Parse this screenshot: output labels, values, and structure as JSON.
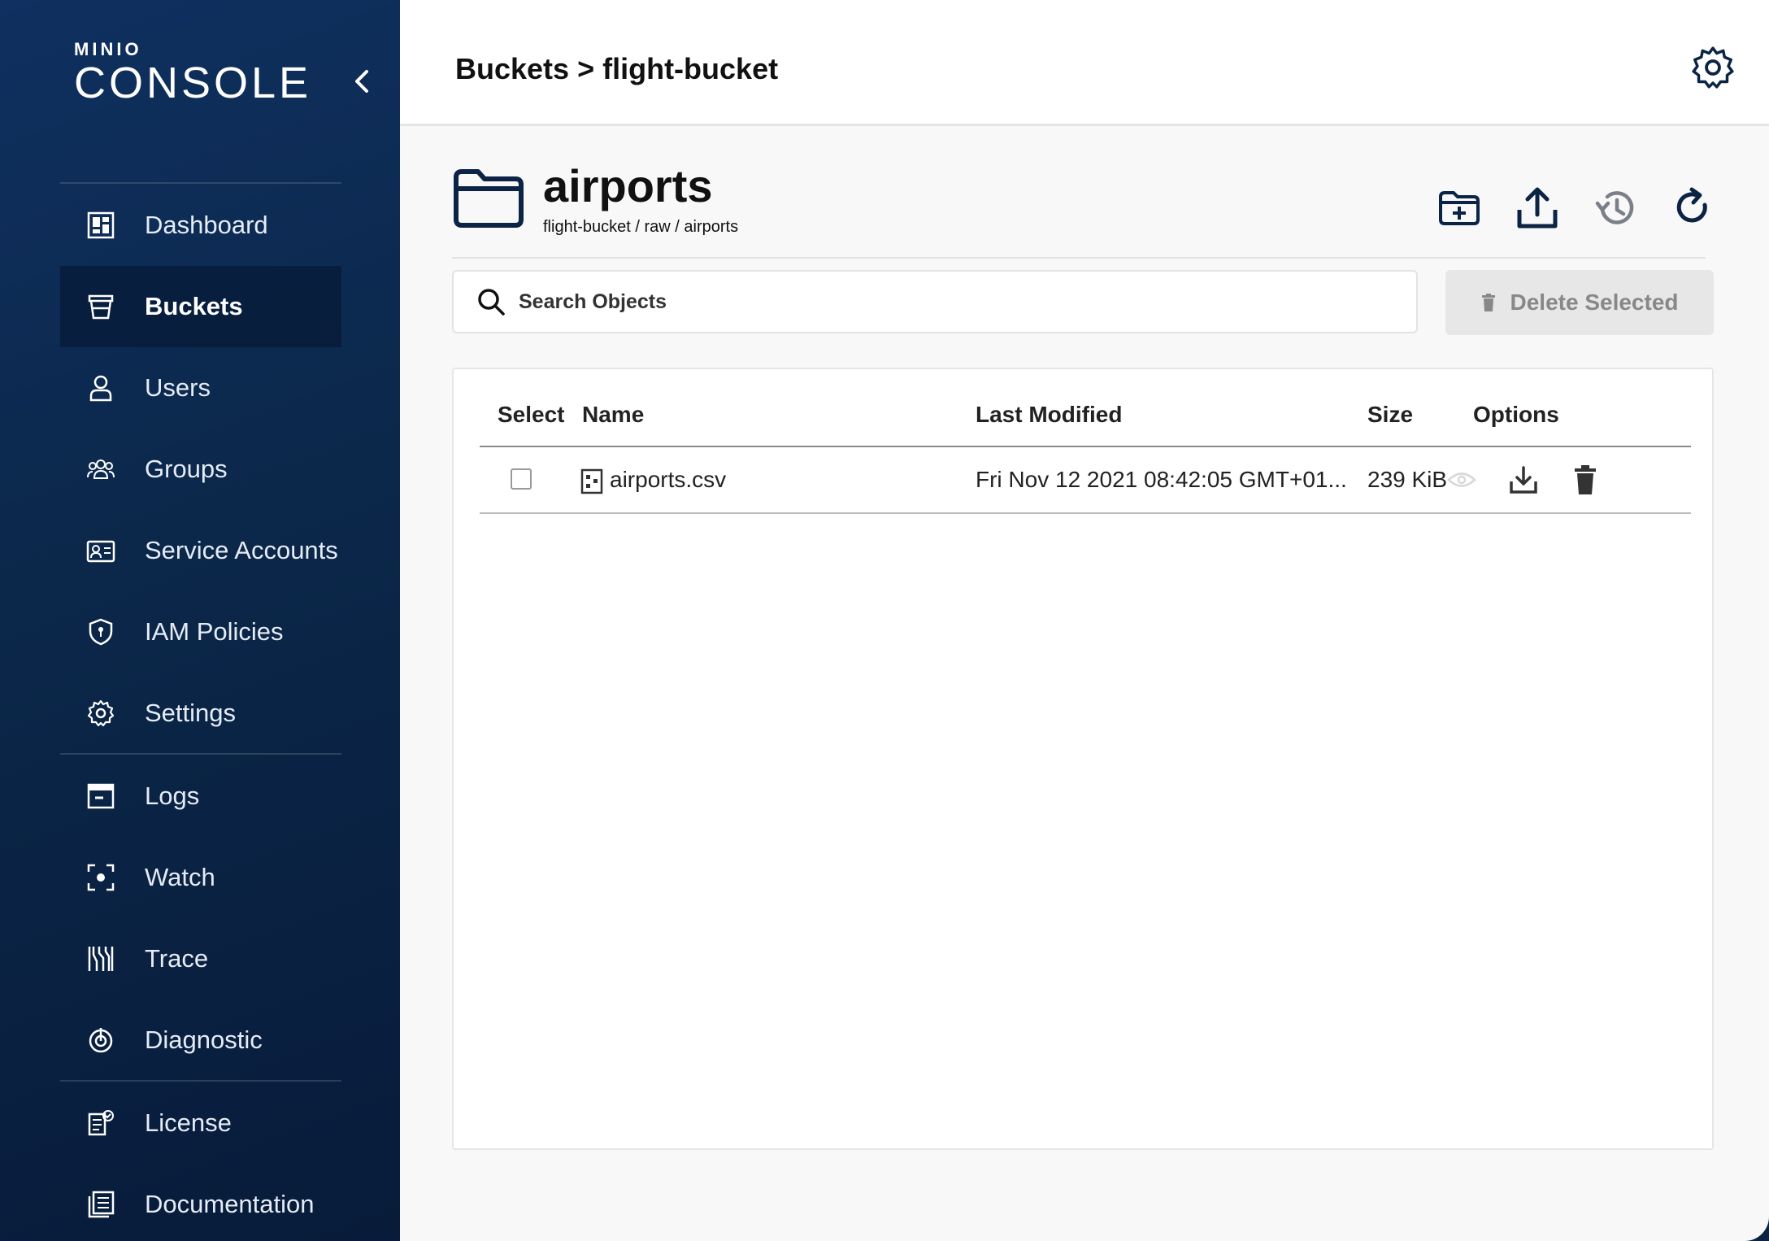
{
  "logo": {
    "top": "MINIO",
    "main": "CONSOLE"
  },
  "sidebar": {
    "items": [
      {
        "label": "Dashboard",
        "icon": "dashboard-icon"
      },
      {
        "label": "Buckets",
        "icon": "bucket-icon",
        "active": true
      },
      {
        "label": "Users",
        "icon": "user-icon"
      },
      {
        "label": "Groups",
        "icon": "groups-icon"
      },
      {
        "label": "Service Accounts",
        "icon": "service-account-icon"
      },
      {
        "label": "IAM Policies",
        "icon": "shield-icon"
      },
      {
        "label": "Settings",
        "icon": "gear-icon"
      },
      {
        "label": "Logs",
        "icon": "logs-icon"
      },
      {
        "label": "Watch",
        "icon": "watch-icon"
      },
      {
        "label": "Trace",
        "icon": "trace-icon"
      },
      {
        "label": "Diagnostic",
        "icon": "diagnostic-icon"
      },
      {
        "label": "License",
        "icon": "license-icon"
      },
      {
        "label": "Documentation",
        "icon": "documentation-icon"
      }
    ]
  },
  "header": {
    "breadcrumb": "Buckets > flight-bucket"
  },
  "folder": {
    "title": "airports",
    "path": "flight-bucket / raw / airports"
  },
  "search": {
    "placeholder": "Search Objects",
    "value": ""
  },
  "actions": {
    "delete_selected": "Delete Selected"
  },
  "table": {
    "columns": [
      "Select",
      "Name",
      "Last Modified",
      "Size",
      "Options"
    ],
    "rows": [
      {
        "name": "airports.csv",
        "last_modified": "Fri Nov 12 2021 08:42:05 GMT+01...",
        "size": "239 KiB"
      }
    ]
  },
  "colors": {
    "sidebar_bg": "#0b2749",
    "accent_dark": "#0b2344",
    "main_bg": "#f8f8f8"
  }
}
